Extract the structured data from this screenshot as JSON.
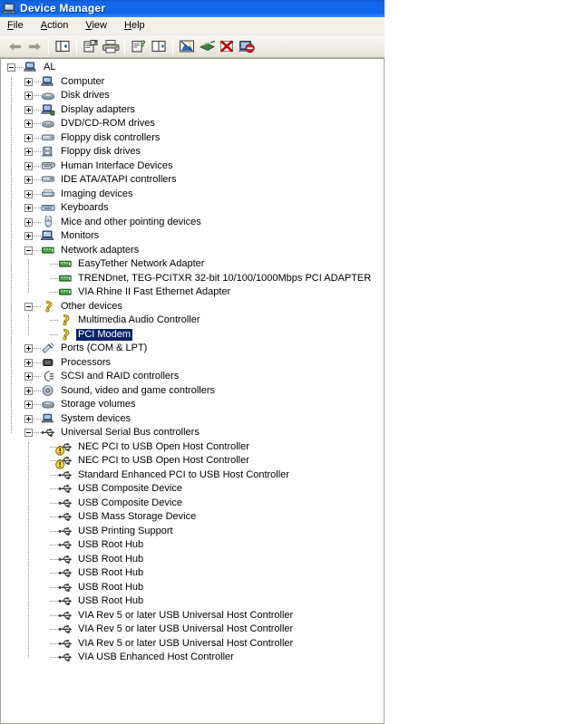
{
  "window": {
    "title": "Device Manager",
    "title_icon": "computer-icon"
  },
  "menubar": {
    "items": [
      {
        "label": "File",
        "accel": "F"
      },
      {
        "label": "Action",
        "accel": "A"
      },
      {
        "label": "View",
        "accel": "V"
      },
      {
        "label": "Help",
        "accel": "H"
      }
    ]
  },
  "toolbar": {
    "buttons": [
      {
        "name": "back-icon",
        "title": "Back"
      },
      {
        "name": "forward-icon",
        "title": "Forward"
      },
      {
        "name": "separator-1",
        "title": ""
      },
      {
        "name": "show-hide-tree-icon",
        "title": "Show/Hide Console Tree"
      },
      {
        "name": "separator-2",
        "title": ""
      },
      {
        "name": "properties-icon",
        "title": "Properties"
      },
      {
        "name": "print-icon",
        "title": "Print"
      },
      {
        "name": "separator-3",
        "title": ""
      },
      {
        "name": "help-icon",
        "title": "Help"
      },
      {
        "name": "view-pane-icon",
        "title": "View"
      },
      {
        "name": "separator-4",
        "title": ""
      },
      {
        "name": "scan-hardware-icon",
        "title": "Scan for hardware changes"
      },
      {
        "name": "update-driver-icon",
        "title": "Update Driver"
      },
      {
        "name": "uninstall-icon",
        "title": "Uninstall"
      },
      {
        "name": "disable-icon",
        "title": "Disable"
      }
    ]
  },
  "colors": {
    "selection": "#0A246A",
    "title_bar": "#0D63E8",
    "warning_yellow": "#FFD700",
    "network_green": "#2E8B2E"
  },
  "tree": {
    "nodes": [
      {
        "label": "AL",
        "level": 0,
        "expander": "minus",
        "icon": "computer-icon"
      },
      {
        "label": "Computer",
        "level": 1,
        "expander": "plus",
        "icon": "computer-icon"
      },
      {
        "label": "Disk drives",
        "level": 1,
        "expander": "plus",
        "icon": "disk-drive-icon"
      },
      {
        "label": "Display adapters",
        "level": 1,
        "expander": "plus",
        "icon": "display-adapter-icon"
      },
      {
        "label": "DVD/CD-ROM drives",
        "level": 1,
        "expander": "plus",
        "icon": "cdrom-icon"
      },
      {
        "label": "Floppy disk controllers",
        "level": 1,
        "expander": "plus",
        "icon": "floppy-controller-icon"
      },
      {
        "label": "Floppy disk drives",
        "level": 1,
        "expander": "plus",
        "icon": "floppy-drive-icon"
      },
      {
        "label": "Human Interface Devices",
        "level": 1,
        "expander": "plus",
        "icon": "hid-icon"
      },
      {
        "label": "IDE ATA/ATAPI controllers",
        "level": 1,
        "expander": "plus",
        "icon": "ide-controller-icon"
      },
      {
        "label": "Imaging devices",
        "level": 1,
        "expander": "plus",
        "icon": "imaging-icon"
      },
      {
        "label": "Keyboards",
        "level": 1,
        "expander": "plus",
        "icon": "keyboard-icon"
      },
      {
        "label": "Mice and other pointing devices",
        "level": 1,
        "expander": "plus",
        "icon": "mouse-icon"
      },
      {
        "label": "Monitors",
        "level": 1,
        "expander": "plus",
        "icon": "monitor-icon"
      },
      {
        "label": "Network adapters",
        "level": 1,
        "expander": "minus",
        "icon": "network-adapter-icon"
      },
      {
        "label": "EasyTether Network Adapter",
        "level": 2,
        "expander": "none",
        "icon": "network-adapter-icon"
      },
      {
        "label": "TRENDnet, TEG-PCITXR  32-bit 10/100/1000Mbps PCI ADAPTER",
        "level": 2,
        "expander": "none",
        "icon": "network-adapter-icon"
      },
      {
        "label": "VIA Rhine II Fast Ethernet Adapter",
        "level": 2,
        "expander": "none",
        "icon": "network-adapter-icon"
      },
      {
        "label": "Other devices",
        "level": 1,
        "expander": "minus",
        "icon": "unknown-device-icon"
      },
      {
        "label": "Multimedia Audio Controller",
        "level": 2,
        "expander": "none",
        "icon": "unknown-device-icon"
      },
      {
        "label": "PCI Modem",
        "level": 2,
        "expander": "none",
        "icon": "unknown-device-icon",
        "selected": true
      },
      {
        "label": "Ports (COM & LPT)",
        "level": 1,
        "expander": "plus",
        "icon": "ports-icon"
      },
      {
        "label": "Processors",
        "level": 1,
        "expander": "plus",
        "icon": "processor-icon"
      },
      {
        "label": "SCSI and RAID controllers",
        "level": 1,
        "expander": "plus",
        "icon": "scsi-icon"
      },
      {
        "label": "Sound, video and game controllers",
        "level": 1,
        "expander": "plus",
        "icon": "sound-icon"
      },
      {
        "label": "Storage volumes",
        "level": 1,
        "expander": "plus",
        "icon": "storage-volume-icon"
      },
      {
        "label": "System devices",
        "level": 1,
        "expander": "plus",
        "icon": "system-device-icon"
      },
      {
        "label": "Universal Serial Bus controllers",
        "level": 1,
        "expander": "minus",
        "icon": "usb-icon"
      },
      {
        "label": "NEC PCI to USB Open Host Controller",
        "level": 2,
        "expander": "none",
        "icon": "usb-icon",
        "warning": true
      },
      {
        "label": "NEC PCI to USB Open Host Controller",
        "level": 2,
        "expander": "none",
        "icon": "usb-icon",
        "warning": true
      },
      {
        "label": "Standard Enhanced PCI to USB Host Controller",
        "level": 2,
        "expander": "none",
        "icon": "usb-icon"
      },
      {
        "label": "USB Composite Device",
        "level": 2,
        "expander": "none",
        "icon": "usb-icon"
      },
      {
        "label": "USB Composite Device",
        "level": 2,
        "expander": "none",
        "icon": "usb-icon"
      },
      {
        "label": "USB Mass Storage Device",
        "level": 2,
        "expander": "none",
        "icon": "usb-icon"
      },
      {
        "label": "USB Printing Support",
        "level": 2,
        "expander": "none",
        "icon": "usb-icon"
      },
      {
        "label": "USB Root Hub",
        "level": 2,
        "expander": "none",
        "icon": "usb-icon"
      },
      {
        "label": "USB Root Hub",
        "level": 2,
        "expander": "none",
        "icon": "usb-icon"
      },
      {
        "label": "USB Root Hub",
        "level": 2,
        "expander": "none",
        "icon": "usb-icon"
      },
      {
        "label": "USB Root Hub",
        "level": 2,
        "expander": "none",
        "icon": "usb-icon"
      },
      {
        "label": "USB Root Hub",
        "level": 2,
        "expander": "none",
        "icon": "usb-icon"
      },
      {
        "label": "VIA Rev 5 or later USB Universal Host Controller",
        "level": 2,
        "expander": "none",
        "icon": "usb-icon"
      },
      {
        "label": "VIA Rev 5 or later USB Universal Host Controller",
        "level": 2,
        "expander": "none",
        "icon": "usb-icon"
      },
      {
        "label": "VIA Rev 5 or later USB Universal Host Controller",
        "level": 2,
        "expander": "none",
        "icon": "usb-icon"
      },
      {
        "label": "VIA USB Enhanced Host Controller",
        "level": 2,
        "expander": "none",
        "icon": "usb-icon"
      }
    ]
  }
}
